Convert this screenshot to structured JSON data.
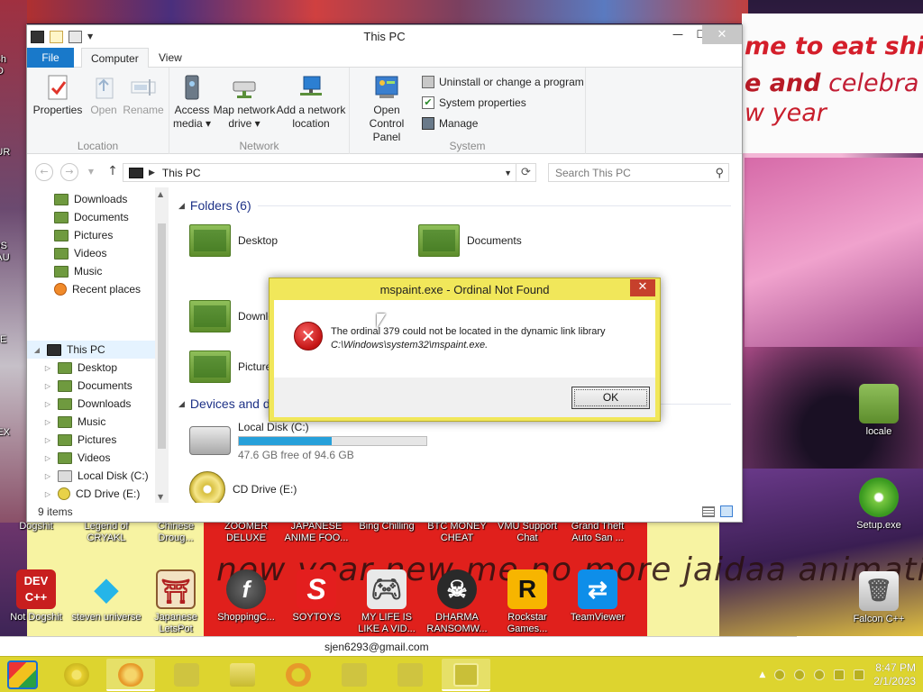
{
  "explorer": {
    "title": "This PC",
    "ribbon_tabs": [
      "File",
      "Computer",
      "View"
    ],
    "ribbon": {
      "location": {
        "name": "Location",
        "buttons": [
          "Properties",
          "Open",
          "Rename"
        ]
      },
      "network": {
        "name": "Network",
        "buttons": [
          [
            "Access",
            "media ▾"
          ],
          [
            "Map network",
            "drive ▾"
          ],
          [
            "Add a network",
            "location"
          ]
        ]
      },
      "system": {
        "name": "System",
        "open_control_panel": [
          "Open Control",
          "Panel"
        ],
        "items": [
          "Uninstall or change a program",
          "System properties",
          "Manage"
        ]
      }
    },
    "address": {
      "path": "This PC",
      "search_placeholder": "Search This PC"
    },
    "nav_pane": {
      "quick": [
        "Downloads",
        "Documents",
        "Pictures",
        "Videos",
        "Music",
        "Recent places"
      ],
      "this_pc_label": "This PC",
      "this_pc_children": [
        "Desktop",
        "Documents",
        "Downloads",
        "Music",
        "Pictures",
        "Videos",
        "Local Disk (C:)",
        "CD Drive (E:)"
      ]
    },
    "content": {
      "folders_header": "Folders (6)",
      "folders": [
        "Desktop",
        "Documents",
        "Downloads",
        "Pictures"
      ],
      "devices_header": "Devices and drives",
      "local_disk": {
        "name": "Local Disk (C:)",
        "free_text": "47.6 GB free of 94.6 GB",
        "used_fraction": 0.497
      },
      "cd_drive": "CD Drive (E:)"
    },
    "status": {
      "items": "9 items"
    }
  },
  "dialog": {
    "title": "mspaint.exe - Ordinal Not Found",
    "message_line1": "The ordinal 379 could not be located in the dynamic link library",
    "message_path": "C:\\Windows\\system32\\mspaint.exe.",
    "ok_label": "OK"
  },
  "desktop": {
    "banner": {
      "line1": "me to eat shit",
      "line2_bold": "e and",
      "line2_rest": " celebra",
      "line3": "w year"
    },
    "wall_scrawl": "new year new me no more jaidaa animations porn",
    "icons_row1": [
      "Dogshit",
      "Legend of CRYAKL",
      "Chinese Droug...",
      "ZOOMER DELUXE",
      "JAPANESE ANIME FOO...",
      "Bing Chilling",
      "BTC MONEY CHEAT",
      "VMU Support Chat",
      "Grand Theft Auto San ..."
    ],
    "icons_row2": [
      "Not Dogshit",
      "steven universe",
      "Japanese LetsPot",
      "ShoppingC...",
      "SOYTOYS",
      "MY LIFE IS LIKE A VID...",
      "DHARMA RANSOMW...",
      "Rockstar Games...",
      "TeamViewer"
    ],
    "right_icons": [
      "locale",
      "Setup.exe",
      "Falcon C++"
    ],
    "left_partial": [
      "Ch",
      "D",
      "FUR",
      "OS",
      "LAU",
      "BE",
      "SEX"
    ]
  },
  "email_text": "sjen6293@gmail.com",
  "taskbar": {
    "clock_time": "8:47 PM",
    "clock_date": "2/1/2023"
  },
  "colors": {
    "file_tab": "#1979ca",
    "dialog_frame": "#f1e75a",
    "taskbar": "#ddd42f",
    "error_red": "#c41414",
    "capacity_fill": "#26a0da"
  }
}
